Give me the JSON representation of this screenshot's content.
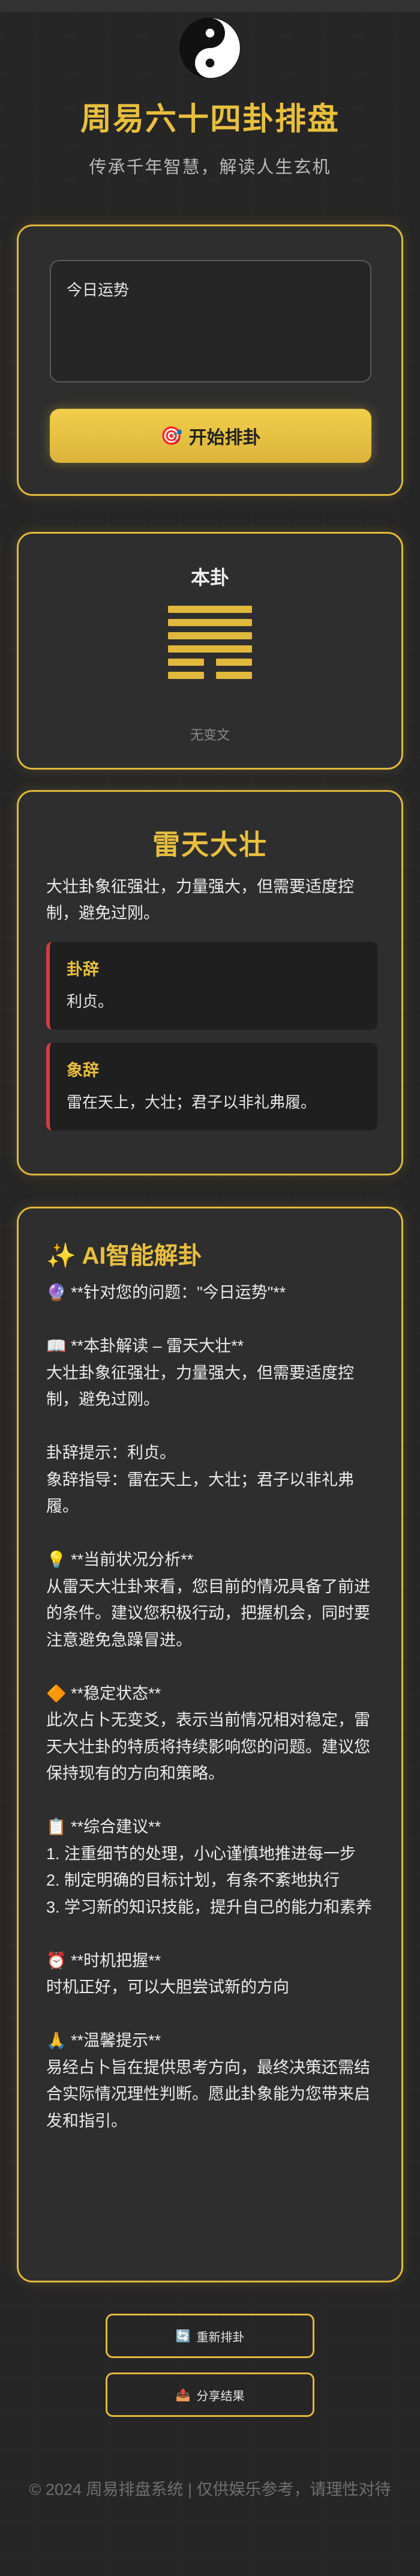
{
  "header": {
    "title": "周易六十四卦排盘",
    "subtitle": "传承千年智慧，解读人生玄机"
  },
  "input": {
    "value": "今日运势",
    "button_icon": "🎯",
    "button_label": "开始排卦"
  },
  "hexagram": {
    "label": "本卦",
    "lines_top_to_bottom": [
      "yang",
      "yang",
      "yang",
      "yang",
      "yin",
      "yin"
    ],
    "no_change_text": "无变文"
  },
  "gua": {
    "name": "雷天大壮",
    "description": "大壮卦象征强壮，力量强大，但需要适度控制，避免过刚。",
    "gua_ci_title": "卦辞",
    "gua_ci_text": "利贞。",
    "xiang_ci_title": "象辞",
    "xiang_ci_text": "雷在天上，大壮；君子以非礼弗履。"
  },
  "ai": {
    "title_icon": "✨",
    "title": "AI智能解卦",
    "body": "🔮 **针对您的问题：\"今日运势\"**\n\n📖 **本卦解读 – 雷天大壮**\n大壮卦象征强壮，力量强大，但需要适度控制，避免过刚。\n\n卦辞提示：利贞。\n象辞指导：雷在天上，大壮；君子以非礼弗履。\n\n💡 **当前状况分析**\n从雷天大壮卦来看，您目前的情况具备了前进的条件。建议您积极行动，把握机会，同时要注意避免急躁冒进。\n\n🔶 **稳定状态**\n此次占卜无变爻，表示当前情况相对稳定，雷天大壮卦的特质将持续影响您的问题。建议您保持现有的方向和策略。\n\n📋 **综合建议**\n1. 注重细节的处理，小心谨慎地推进每一步\n2. 制定明确的目标计划，有条不紊地执行\n3. 学习新的知识技能，提升自己的能力和素养\n\n⏰ **时机把握**\n时机正好，可以大胆尝试新的方向\n\n🙏 **温馨提示**\n易经占卜旨在提供思考方向，最终决策还需结合实际情况理性判断。愿此卦象能为您带来启发和指引。"
  },
  "actions": {
    "redo_icon": "🔄",
    "redo_label": "重新排卦",
    "share_icon": "📤",
    "share_label": "分享结果"
  },
  "footer": {
    "text": "© 2024 周易排盘系统 | 仅供娱乐参考，请理性对待"
  },
  "colors": {
    "accent": "#e0b83c",
    "background": "#262626",
    "card": "#2e2e2e",
    "quote_border": "#d33a45"
  }
}
